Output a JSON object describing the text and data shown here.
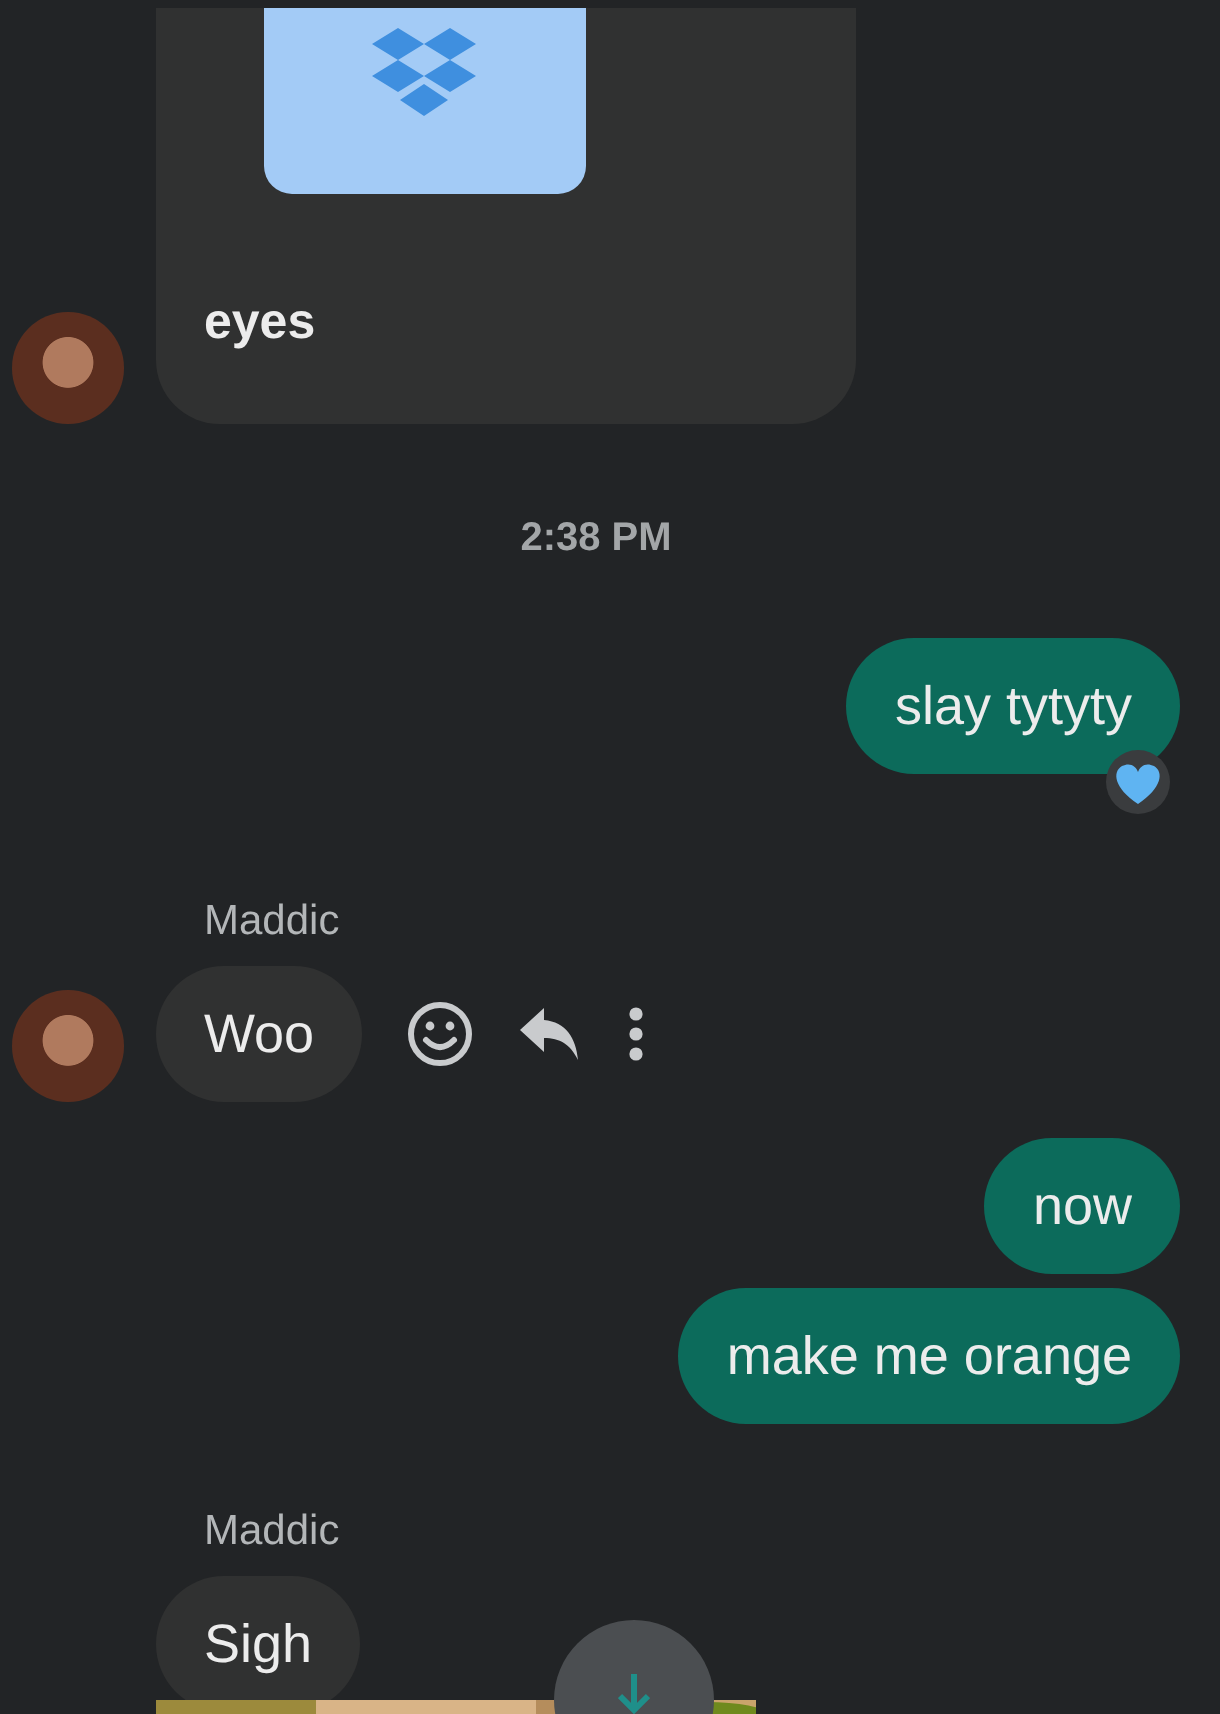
{
  "messages": [
    {
      "kind": "attachment",
      "outgoing": false,
      "text": "eyes",
      "avatar": true
    },
    {
      "kind": "time",
      "text": "2:38 PM"
    },
    {
      "kind": "text",
      "outgoing": true,
      "text": "slay tytyty",
      "reacted": true
    },
    {
      "kind": "text",
      "outgoing": false,
      "sender": "Maddic",
      "text": "Woo",
      "avatar": true,
      "actions": true
    },
    {
      "kind": "text",
      "outgoing": true,
      "text": "now"
    },
    {
      "kind": "text",
      "outgoing": true,
      "text": "make me orange"
    },
    {
      "kind": "text",
      "outgoing": false,
      "sender": "Maddic",
      "text": "Sigh"
    }
  ],
  "scroll_button": true
}
